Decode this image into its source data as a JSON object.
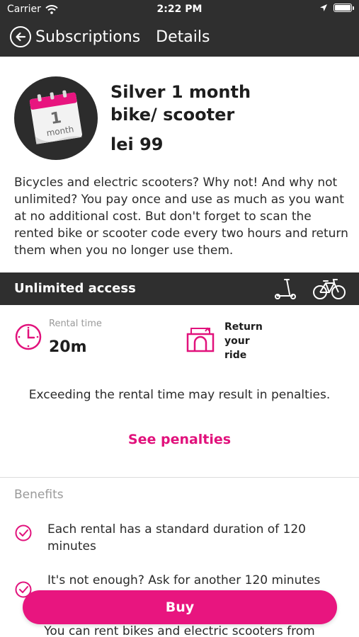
{
  "status_bar": {
    "carrier": "Carrier",
    "time": "2:22 PM"
  },
  "nav": {
    "back_label": "Subscriptions",
    "title": "Details"
  },
  "product": {
    "calendar_day": "1",
    "calendar_unit": "month",
    "title_line1": "Silver 1 month",
    "title_line2": "bike/ scooter",
    "price": "lei 99"
  },
  "description": "Bicycles and electric scooters? Why not! And why not unlimited? You pay once and use as much as you want at no additional cost. But don't forget to scan the rented bike or scooter code every two hours and return them when you no longer use them.",
  "access": {
    "label": "Unlimited access"
  },
  "rental": {
    "label": "Rental time",
    "value": "20m",
    "return_line1": "Return",
    "return_line2": "your",
    "return_line3": "ride"
  },
  "penalties": {
    "notice": "Exceeding the rental time may result in penalties.",
    "link": "See penalties"
  },
  "benefits": {
    "header": "Benefits",
    "items": [
      "Each rental has a standard duration of 120 minutes",
      "It's not enough? Ask for another 120 minutes"
    ]
  },
  "buy_label": "Buy",
  "footer_text": "You can rent bikes and electric scooters from",
  "colors": {
    "accent": "#e8157f",
    "dark_bar": "#2f2f2f"
  },
  "icons": [
    "wifi-icon",
    "location-arrow-icon",
    "battery-icon",
    "back-arrow-icon",
    "calendar-icon",
    "scooter-icon",
    "bicycle-icon",
    "clock-icon",
    "return-ride-icon",
    "check-icon"
  ]
}
